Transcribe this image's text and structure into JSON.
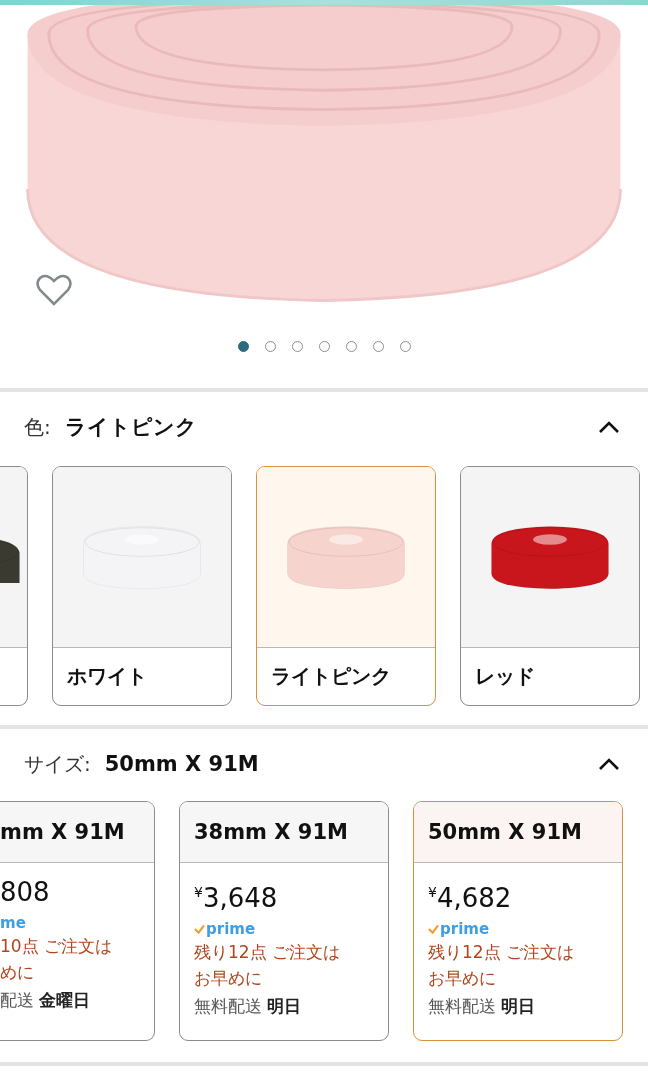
{
  "gallery": {
    "dots": [
      {
        "selected": true
      },
      {
        "selected": false
      },
      {
        "selected": false
      },
      {
        "selected": false
      },
      {
        "selected": false
      },
      {
        "selected": false
      },
      {
        "selected": false
      }
    ],
    "favorited": false
  },
  "color_section": {
    "label": "色:",
    "value": "ライトピンク",
    "expanded": true,
    "options": [
      {
        "color": "#3a3a30",
        "selected": false,
        "partial": true
      },
      {
        "label": "ホワイト",
        "color": "#f4f4f6",
        "selected": false,
        "partial": false
      },
      {
        "label": "ライトピンク",
        "color": "#f6d3cd",
        "selected": true,
        "partial": false
      },
      {
        "label": "レッド",
        "color": "#c8161c",
        "selected": false,
        "partial": false
      }
    ]
  },
  "size_section": {
    "label": "サイズ:",
    "value": "50mm X 91M",
    "expanded": true,
    "options": [
      {
        "label": "mm X 91M",
        "price": "808",
        "prime": "me",
        "stock": [
          "10点 ご注文は",
          "めに"
        ],
        "delivery": "配送 **金曜日**",
        "selected": false,
        "partial": true
      },
      {
        "label": "38mm X 91M",
        "price": "$^{¥}$3,648",
        "prime": "prime",
        "stock": [
          "残り12点 ご注文は",
          "お早めに"
        ],
        "delivery": "無料配送 **明日**",
        "selected": false,
        "partial": false
      },
      {
        "label": "50mm X 91M",
        "price": "$^{¥}$4,682",
        "prime": "prime",
        "stock": [
          "残り12点 ご注文は",
          "お早めに"
        ],
        "delivery": "無料配送 **明日**",
        "selected": true,
        "partial": false
      }
    ]
  }
}
